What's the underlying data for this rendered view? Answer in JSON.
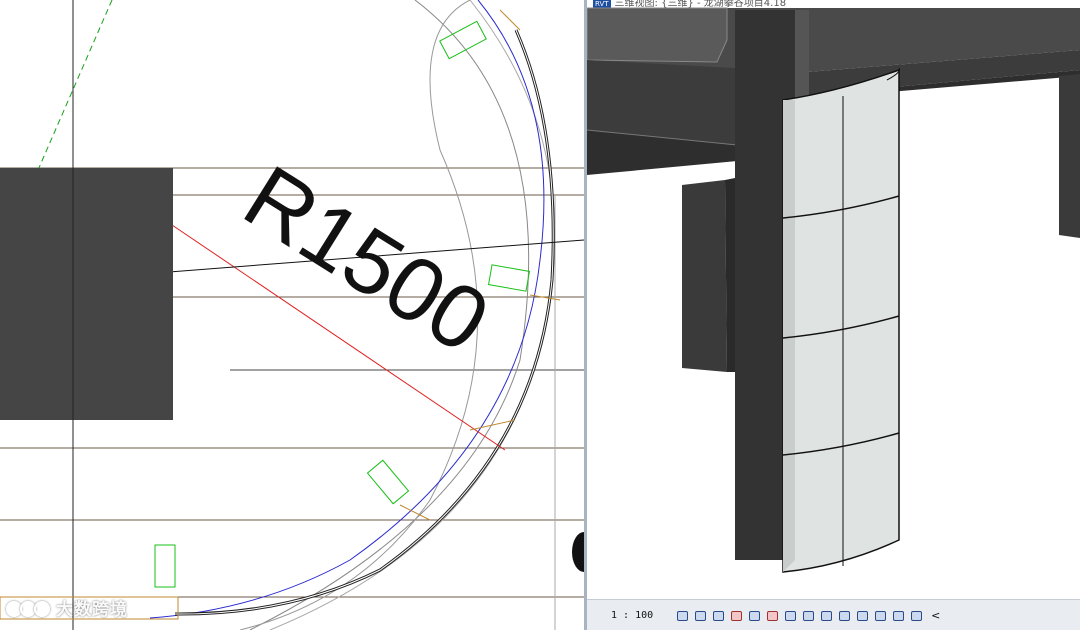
{
  "plan": {
    "dimension_label": "R1500"
  },
  "view3d": {
    "app_badge": "RVT",
    "window_title": "三维视图: {三维} - 龙湖攀谷项目4.18"
  },
  "statusbar": {
    "scale": "1 : 100",
    "tools": [
      "detail-level-icon",
      "visual-style-icon",
      "sun-path-icon",
      "shadows-icon",
      "crop-view-icon",
      "show-crop-icon",
      "unlock-3d-icon",
      "temporary-hide-icon",
      "reveal-hidden-icon",
      "temporary-view-icon",
      "worksharing-icon",
      "analytical-icon",
      "highlight-displacement-icon",
      "reveal-constraints-icon"
    ],
    "more_symbol": "<"
  },
  "watermark": {
    "text": "大数跨境"
  },
  "colors": {
    "concrete_dark": "#454545",
    "column_light": "#dfe3e1",
    "plan_blue": "#2a2ad0",
    "plan_red": "#e02020",
    "plan_green": "#18c018",
    "plan_orange": "#c08a30"
  }
}
